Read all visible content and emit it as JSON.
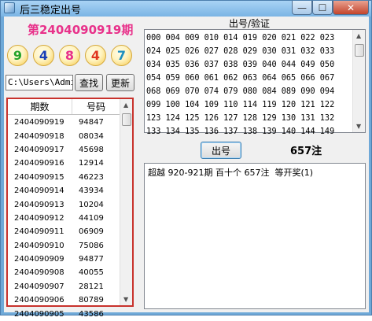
{
  "window": {
    "title": "后三稳定出号"
  },
  "header": {
    "period_title": "第2404090919期"
  },
  "balls": [
    {
      "value": "9",
      "color": "#26a32b"
    },
    {
      "value": "4",
      "color": "#1a3fb6"
    },
    {
      "value": "8",
      "color": "#e8318a"
    },
    {
      "value": "4",
      "color": "#e0351f"
    },
    {
      "value": "7",
      "color": "#1d8fbf"
    }
  ],
  "path": {
    "value": "C:\\Users\\Admir"
  },
  "buttons": {
    "search": "查找",
    "update": "更新",
    "draw": "出号"
  },
  "history": {
    "columns": [
      "期数",
      "号码"
    ],
    "rows": [
      [
        "2404090919",
        "94847"
      ],
      [
        "2404090918",
        "08034"
      ],
      [
        "2404090917",
        "45698"
      ],
      [
        "2404090916",
        "12914"
      ],
      [
        "2404090915",
        "46223"
      ],
      [
        "2404090914",
        "43934"
      ],
      [
        "2404090913",
        "10204"
      ],
      [
        "2404090912",
        "44109"
      ],
      [
        "2404090911",
        "06909"
      ],
      [
        "2404090910",
        "75086"
      ],
      [
        "2404090909",
        "94877"
      ],
      [
        "2404090908",
        "40055"
      ],
      [
        "2404090907",
        "28121"
      ],
      [
        "2404090906",
        "80789"
      ],
      [
        "2404090905",
        "43586"
      ]
    ]
  },
  "verify": {
    "label": "出号/验证",
    "numbers_text": "000 004 009 010 014 019 020 021 022 023\n024 025 026 027 028 029 030 031 032 033\n034 035 036 037 038 039 040 044 049 050\n054 059 060 061 062 063 064 065 066 067\n068 069 070 074 079 080 084 089 090 094\n099 100 104 109 110 114 119 120 121 122\n123 124 125 126 127 128 129 130 131 132\n133 134 135 136 137 138 139 140 144 149"
  },
  "count_label": "657注",
  "result": {
    "text": "超越 920-921期 百十个 657注  等开奖(1)"
  }
}
